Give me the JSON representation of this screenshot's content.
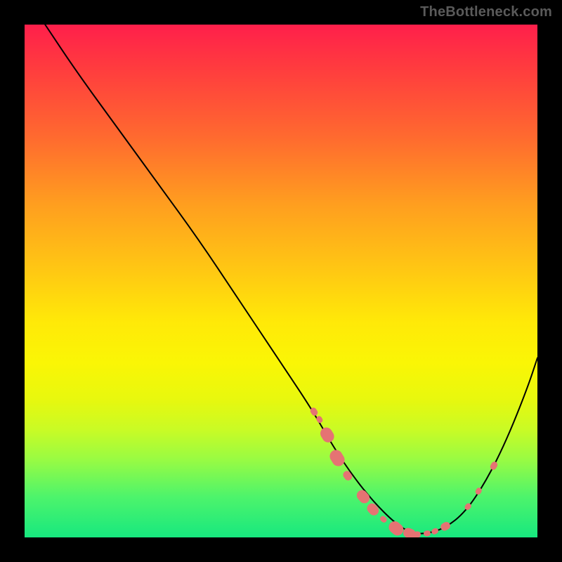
{
  "watermark": "TheBottleneck.com",
  "chart_data": {
    "type": "line",
    "title": "",
    "xlabel": "",
    "ylabel": "",
    "xlim": [
      0,
      100
    ],
    "ylim": [
      0,
      100
    ],
    "grid": false,
    "series": [
      {
        "name": "curve",
        "x": [
          4,
          10,
          18,
          26,
          34,
          42,
          50,
          56,
          60,
          64,
          68,
          72,
          75,
          78,
          82,
          86,
          90,
          94,
          98,
          100
        ],
        "y": [
          100,
          91,
          80,
          69,
          58,
          46,
          34,
          25,
          18,
          12,
          7,
          3,
          1,
          0.6,
          1.8,
          5,
          11,
          19,
          29,
          35
        ]
      }
    ],
    "markers": [
      {
        "x": 56.5,
        "y": 24.5,
        "size": 12
      },
      {
        "x": 57.5,
        "y": 23.0,
        "size": 10
      },
      {
        "x": 59.0,
        "y": 20.0,
        "size": 22
      },
      {
        "x": 61.0,
        "y": 15.5,
        "size": 24
      },
      {
        "x": 63.0,
        "y": 12.0,
        "size": 14
      },
      {
        "x": 66.0,
        "y": 8.0,
        "size": 20
      },
      {
        "x": 68.0,
        "y": 5.5,
        "size": 18
      },
      {
        "x": 70.0,
        "y": 3.5,
        "size": 10
      },
      {
        "x": 72.5,
        "y": 1.8,
        "size": 22
      },
      {
        "x": 75.0,
        "y": 0.8,
        "size": 18
      },
      {
        "x": 76.5,
        "y": 0.6,
        "size": 12
      },
      {
        "x": 78.5,
        "y": 0.8,
        "size": 10
      },
      {
        "x": 80.0,
        "y": 1.3,
        "size": 10
      },
      {
        "x": 82.0,
        "y": 2.2,
        "size": 14
      },
      {
        "x": 86.5,
        "y": 6.0,
        "size": 10
      },
      {
        "x": 88.5,
        "y": 9.0,
        "size": 10
      },
      {
        "x": 91.5,
        "y": 14.0,
        "size": 12
      }
    ],
    "colors": {
      "curve": "#000000",
      "marker": "#e57373",
      "gradient_top": "#ff1f4b",
      "gradient_bottom": "#17e87f"
    }
  }
}
